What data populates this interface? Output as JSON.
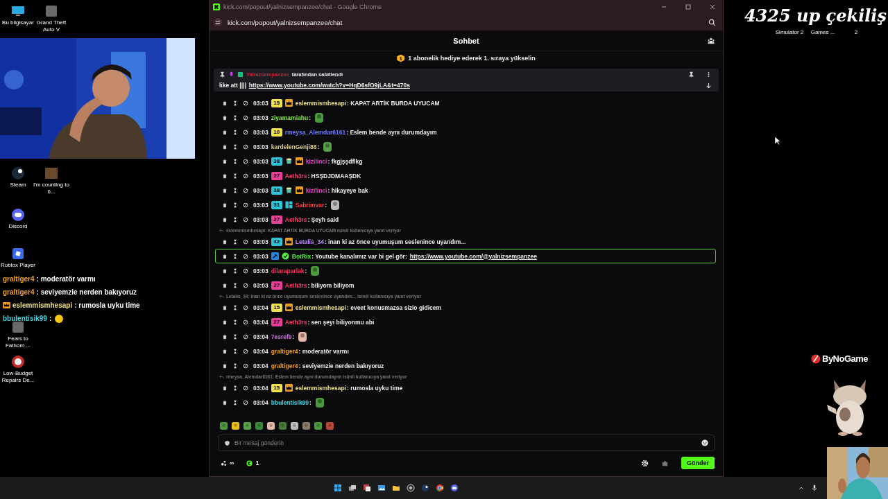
{
  "desktop": {
    "icons_left": [
      {
        "label": "Bu bilgisayar",
        "kind": "monitor"
      },
      {
        "label": "Grand Theft Auto V",
        "kind": "game"
      },
      {
        "label": "Steam",
        "kind": "steam"
      },
      {
        "label": "I'm counting to 6...",
        "kind": "thumbnail"
      },
      {
        "label": "Discord",
        "kind": "discord"
      },
      {
        "label": "Roblox Player",
        "kind": "roblox"
      },
      {
        "label": "Fears to Fathom ...",
        "kind": "game"
      },
      {
        "label": "Low-Budget Repairs De...",
        "kind": "badge"
      }
    ],
    "icons_right": [
      {
        "label": "Simulator 2"
      },
      {
        "label": "Games ..."
      },
      {
        "label": "2"
      }
    ]
  },
  "stream_overlay": {
    "headline": "4325 up çekiliş",
    "sponsor": "ByNoGame",
    "chat": [
      {
        "user": "graltiger4",
        "color": "#f0a020",
        "text": ": moderatör varmı",
        "crown": false,
        "emote": false
      },
      {
        "user": "graltiger4",
        "color": "#f0a020",
        "text": ": seviyemzie nerden bakıyoruz",
        "crown": false,
        "emote": false
      },
      {
        "user": "eslemmismhesapi",
        "color": "#efe08a",
        "text": ": rumosla uyku time",
        "crown": true,
        "emote": false
      },
      {
        "user": "bbulentisik99",
        "color": "#3ad6e6",
        "text": ":",
        "crown": false,
        "emote": true
      }
    ]
  },
  "browser": {
    "title": "kick.com/popout/yalnizsempanzee/chat - Google Chrome",
    "url": "kick.com/popout/yalnizsempanzee/chat",
    "chat": {
      "heading": "Sohbet",
      "banner": {
        "badge": "1",
        "text": "1 abonelik hediye ederek 1. sıraya yükselin"
      },
      "pinned": {
        "user": "Yalnizsempanzee",
        "note": "tarafından sabitlendi",
        "text": "like att ||||",
        "link": "https://www.youtube.com/watch?v=HqD6sfO9jLA&t=470s"
      },
      "messages": [
        {
          "time": "03:03",
          "badges": [
            {
              "kind": "tier",
              "label": "15",
              "color": "#f2e24a"
            },
            {
              "kind": "crown"
            }
          ],
          "user": "eslemmismhesapi",
          "color": "#efe08a",
          "text": ": KAPAT ARTİK BURDA UYUCAM",
          "emote": false,
          "highlighted": false
        },
        {
          "time": "03:03",
          "user": "ziyamamiahu",
          "color": "#86e83a",
          "text": ":",
          "emote": true,
          "highlighted": false
        },
        {
          "time": "03:03",
          "badges": [
            {
              "kind": "tier",
              "label": "10",
              "color": "#f2e24a"
            }
          ],
          "user": "rmeysa_Alemdar6161",
          "color": "#6f7bff",
          "text": ": Eslem bende aynı durumdayım",
          "emote": false,
          "highlighted": false
        },
        {
          "time": "03:03",
          "user": "kardelenGenji88",
          "color": "#dccb8c",
          "text": ":",
          "emote": true,
          "highlighted": false
        },
        {
          "time": "03:03",
          "badges": [
            {
              "kind": "tier",
              "label": "38",
              "color": "#2cc4d8"
            },
            {
              "kind": "gift"
            },
            {
              "kind": "crown"
            }
          ],
          "user": "kizilinci",
          "color": "#e040c8",
          "text": ": fkgjşşdflkg",
          "emote": false,
          "highlighted": false
        },
        {
          "time": "03:03",
          "badges": [
            {
              "kind": "tier",
              "label": "27",
              "color": "#e8409a"
            }
          ],
          "user": "Aeth3rs",
          "color": "#ff3a6a",
          "text": ": HSŞDJDMAAŞDK",
          "emote": false,
          "highlighted": false
        },
        {
          "time": "03:03",
          "badges": [
            {
              "kind": "tier",
              "label": "38",
              "color": "#2cc4d8"
            },
            {
              "kind": "gift"
            },
            {
              "kind": "crown"
            }
          ],
          "user": "kizilinci",
          "color": "#e040c8",
          "text": ": hikayeye bak",
          "emote": false,
          "highlighted": false
        },
        {
          "time": "03:03",
          "badges": [
            {
              "kind": "tier",
              "label": "31",
              "color": "#2cc4d8"
            },
            {
              "kind": "blocks"
            }
          ],
          "user": "Sabrimvar",
          "color": "#ff4040",
          "text": ":",
          "emote": true,
          "highlighted": false
        },
        {
          "time": "03:03",
          "badges": [
            {
              "kind": "tier",
              "label": "27",
              "color": "#e8409a"
            }
          ],
          "user": "Aeth3rs",
          "color": "#ff3a6a",
          "text": ": Şeyh said",
          "emote": false,
          "highlighted": false
        },
        {
          "reply_to": "eslemmismhesapi: KAPAT ARTİK BURDA UYUCAM isimli kullanıcıya yanıt veriyor",
          "time": "03:03",
          "badges": [
            {
              "kind": "tier",
              "label": "32",
              "color": "#2cc4d8"
            },
            {
              "kind": "crown"
            }
          ],
          "user": "Letalis_34",
          "color": "#c08cff",
          "text": ": inan ki az önce uyumuşum seslenince uyandım...",
          "emote": false,
          "highlighted": false
        },
        {
          "time": "03:03",
          "badges": [
            {
              "kind": "bot"
            },
            {
              "kind": "verified"
            }
          ],
          "user": "BotRix",
          "color": "#52f03a",
          "text": ": Youtube kanalımız var bi gel gör:",
          "link": "https://www.youtube.com/@yalnizsempanzee",
          "emote": false,
          "highlighted": true
        },
        {
          "time": "03:03",
          "user": "dilaraparlak",
          "color": "#ff3060",
          "text": ":",
          "emote": true,
          "highlighted": false
        },
        {
          "time": "03:03",
          "badges": [
            {
              "kind": "tier",
              "label": "27",
              "color": "#e8409a"
            }
          ],
          "user": "Aeth3rs",
          "color": "#ff3a6a",
          "text": ": biliyom biliyom",
          "emote": false,
          "highlighted": false
        },
        {
          "reply_to": "Letalis_34: inan ki az önce uyumuşum seslenince uyandım... isimli kullanıcıya yanıt veriyor",
          "time": "03:04",
          "badges": [
            {
              "kind": "tier",
              "label": "15",
              "color": "#f2e24a"
            },
            {
              "kind": "crown"
            }
          ],
          "user": "eslemmismhesapi",
          "color": "#efe08a",
          "text": ": eveet konusmazsa sizio gidicem",
          "emote": false,
          "highlighted": false
        },
        {
          "time": "03:04",
          "badges": [
            {
              "kind": "tier",
              "label": "27",
              "color": "#e8409a"
            }
          ],
          "user": "Aeth3rs",
          "color": "#ff3a6a",
          "text": ": sen şeyi biliyonmu abi",
          "emote": false,
          "highlighted": false
        },
        {
          "time": "03:04",
          "user": "7esref9",
          "color": "#d070e0",
          "text": ":",
          "emote": true,
          "highlighted": false
        },
        {
          "time": "03:04",
          "user": "graltiger4",
          "color": "#f0a020",
          "text": ": moderatör varmı",
          "emote": false,
          "highlighted": false
        },
        {
          "time": "03:04",
          "user": "graltiger4",
          "color": "#f0a020",
          "text": ": seviyemzie nerden bakıyoruz",
          "emote": false,
          "highlighted": false
        },
        {
          "reply_to": "rmeysa_Alemdar6161: Eslem bende aynı durumdayım isimli kullanıcıya yanıt veriyor",
          "time": "03:04",
          "badges": [
            {
              "kind": "tier",
              "label": "15",
              "color": "#f2e24a"
            },
            {
              "kind": "crown"
            }
          ],
          "user": "eslemmismhesapi",
          "color": "#efe08a",
          "text": ": rumosla uyku time",
          "emote": false,
          "highlighted": false
        },
        {
          "time": "03:04",
          "user": "bbulentisik99",
          "color": "#3ad6e6",
          "text": ":",
          "emote": true,
          "highlighted": false
        }
      ],
      "input": {
        "placeholder": "Bir mesaj gönderin"
      },
      "points": "∞",
      "kick_count": "1",
      "send": "Gönder"
    }
  }
}
